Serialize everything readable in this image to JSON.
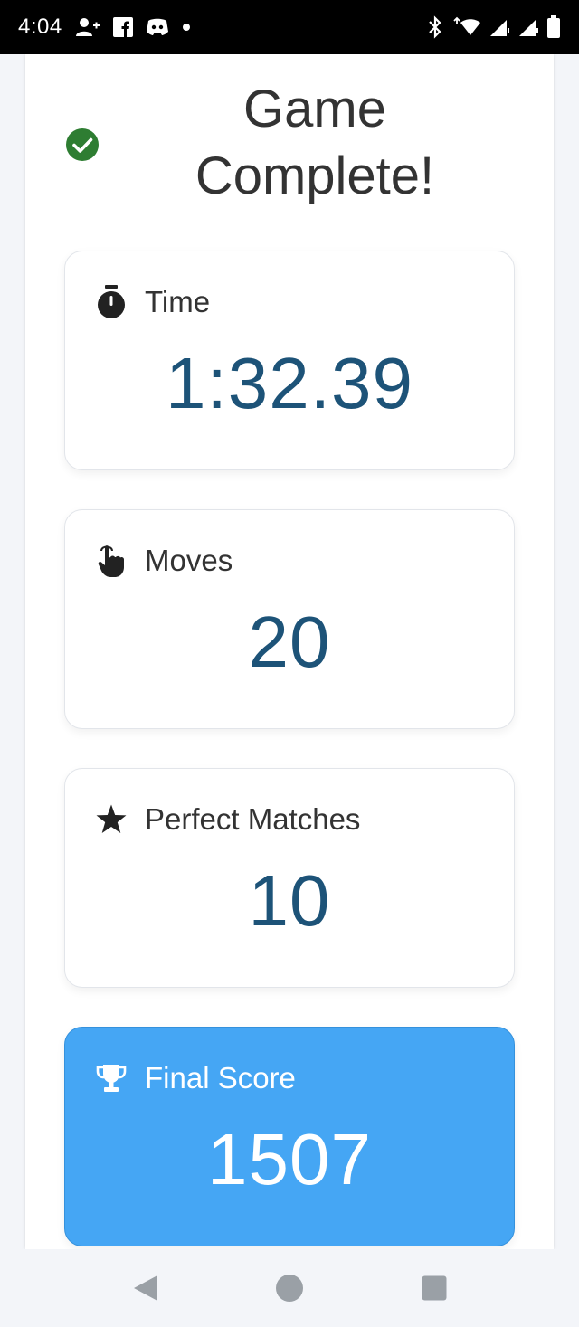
{
  "status_bar": {
    "time": "4:04",
    "left_icons": [
      "person-add-icon",
      "facebook-icon",
      "discord-icon",
      "dot-icon"
    ],
    "right_icons": [
      "bluetooth-icon",
      "wifi-icon",
      "signal-icon",
      "signal-icon",
      "battery-icon"
    ]
  },
  "header": {
    "title": "Game Complete!",
    "icon": "check-circle-icon",
    "icon_color": "#2e7d32"
  },
  "stats": {
    "time": {
      "label": "Time",
      "value": "1:32.39",
      "icon": "stopwatch-icon"
    },
    "moves": {
      "label": "Moves",
      "value": "20",
      "icon": "pointer-hand-icon"
    },
    "perfect": {
      "label": "Perfect Matches",
      "value": "10",
      "icon": "star-icon"
    },
    "score": {
      "label": "Final Score",
      "value": "1507",
      "icon": "trophy-icon"
    }
  },
  "colors": {
    "value_text": "#1d5378",
    "score_card_bg": "#45a6f4",
    "label_text": "#333333"
  },
  "nav_bar": {
    "buttons": [
      "back-icon",
      "home-icon",
      "recents-icon"
    ]
  }
}
